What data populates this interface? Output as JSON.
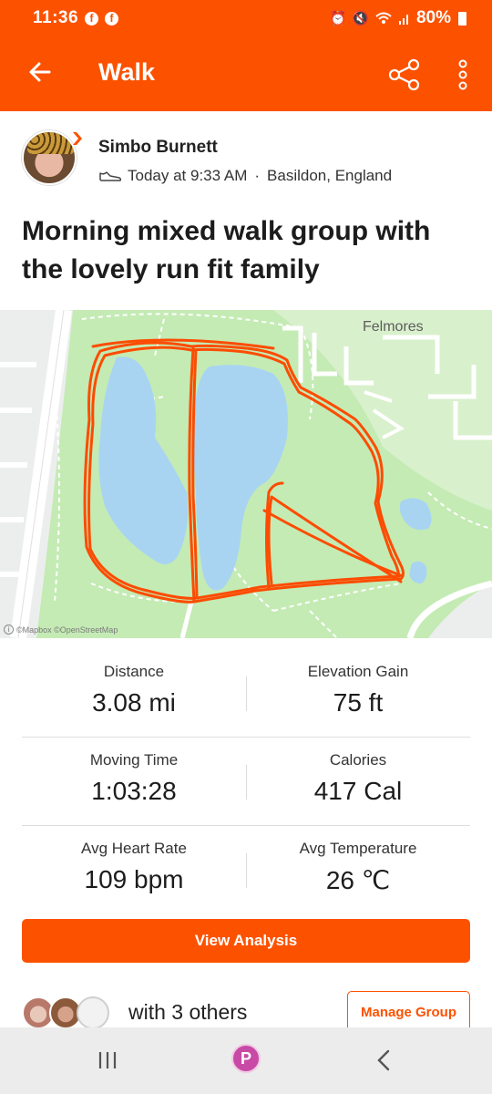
{
  "status_bar": {
    "time": "11:36",
    "battery": "80%"
  },
  "app_bar": {
    "title": "Walk"
  },
  "activity": {
    "athlete_name": "Simbo Burnett",
    "datetime": "Today at 9:33 AM",
    "separator": "·",
    "location": "Basildon, England",
    "title": "Morning mixed walk group with the lovely run fit family"
  },
  "map": {
    "place_label": "Felmores",
    "attribution": "©Mapbox ©OpenStreetMap",
    "route_color": "#fc4c02",
    "water_color": "#a8d4f2",
    "park_color": "#bfe8b0"
  },
  "stats": [
    {
      "label": "Distance",
      "value": "3.08 mi"
    },
    {
      "label": "Elevation Gain",
      "value": "75 ft"
    },
    {
      "label": "Moving Time",
      "value": "1:03:28"
    },
    {
      "label": "Calories",
      "value": "417 Cal"
    },
    {
      "label": "Avg Heart Rate",
      "value": "109 bpm"
    },
    {
      "label": "Avg Temperature",
      "value": "26 ℃"
    }
  ],
  "buttons": {
    "view_analysis": "View Analysis",
    "manage_group": "Manage Group"
  },
  "group": {
    "text": "with 3 others"
  },
  "theme": {
    "accent": "#fc5200"
  },
  "icons": {
    "back": "arrow-left-icon",
    "share": "share-icon",
    "more": "more-vertical-icon",
    "activity_type": "shoe-icon",
    "nav_recents": "recents-icon",
    "nav_home": "home-icon",
    "nav_back": "chevron-left-icon"
  }
}
